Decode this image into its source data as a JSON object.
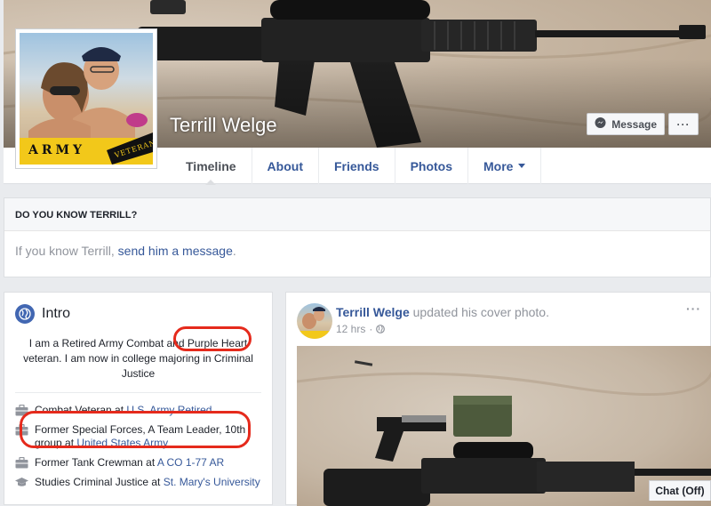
{
  "profile": {
    "name": "Terrill Welge",
    "avatar_banner_text": "ARMY",
    "avatar_banner_subtext": "VETERAN",
    "message_button": "Message",
    "more_button": "···"
  },
  "tabs": [
    {
      "label": "Timeline",
      "active": true
    },
    {
      "label": "About"
    },
    {
      "label": "Friends"
    },
    {
      "label": "Photos"
    },
    {
      "label": "More"
    }
  ],
  "know": {
    "heading": "DO YOU KNOW TERRILL?",
    "text_prefix": "If you know Terrill, ",
    "link": "send him a message",
    "text_suffix": "."
  },
  "intro": {
    "title": "Intro",
    "bio_line1_a": "I am a Retired Army Combat and ",
    "bio_line1_b": "Purple Heart",
    "bio_line2": "veteran. I am now in college majoring in Criminal",
    "bio_line3": "Justice",
    "facts": [
      {
        "icon": "briefcase-icon",
        "text": "Combat Veteran at ",
        "link": "U.S. Army Retired"
      },
      {
        "icon": "briefcase-icon",
        "text": "Former Special Forces, A Team Leader, 10th group at ",
        "link": "United States Army"
      },
      {
        "icon": "briefcase-icon",
        "text": "Former Tank Crewman at ",
        "link": "A CO 1-77 AR"
      },
      {
        "icon": "graduation-cap-icon",
        "text": "Studies Criminal Justice at ",
        "link": "St. Mary's University"
      }
    ]
  },
  "post": {
    "author": "Terrill Welge",
    "action": " updated his cover photo.",
    "time": "12 hrs",
    "audience_icon": "globe-icon",
    "menu": "···"
  },
  "chat": {
    "label": "Chat (Off)"
  },
  "colors": {
    "link": "#365899",
    "highlight": "#e52a1c",
    "brand": "#4267b2"
  }
}
